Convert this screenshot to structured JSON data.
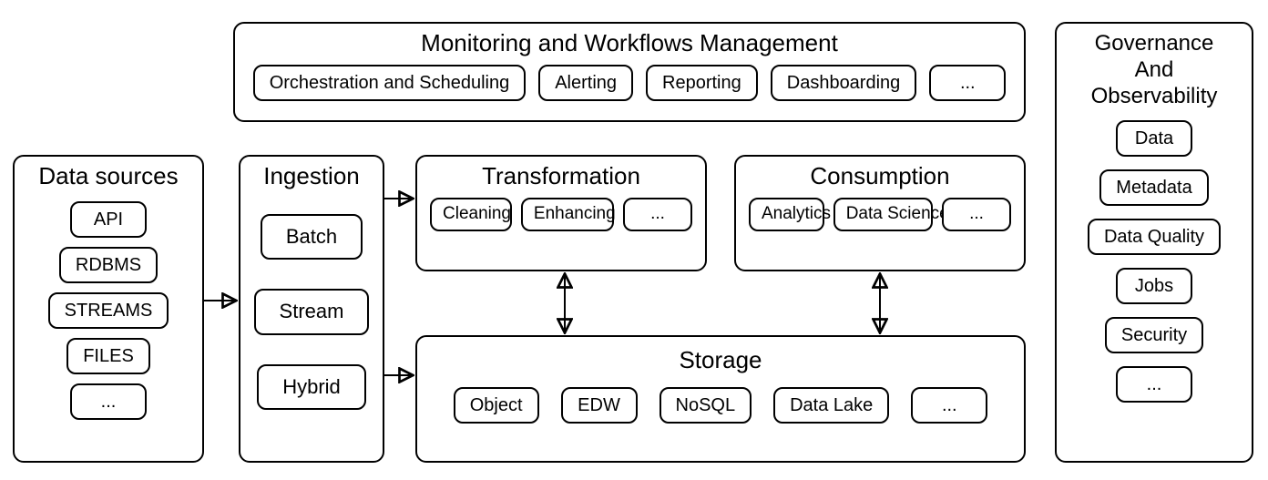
{
  "monitoring": {
    "title": "Monitoring and Workflows Management",
    "items": [
      "Orchestration and Scheduling",
      "Alerting",
      "Reporting",
      "Dashboarding",
      "..."
    ]
  },
  "data_sources": {
    "title": "Data sources",
    "items": [
      "API",
      "RDBMS",
      "STREAMS",
      "FILES",
      "..."
    ]
  },
  "ingestion": {
    "title": "Ingestion",
    "items": [
      "Batch",
      "Stream",
      "Hybrid"
    ]
  },
  "transformation": {
    "title": "Transformation",
    "items": [
      "Cleaning",
      "Enhancing",
      "..."
    ]
  },
  "consumption": {
    "title": "Consumption",
    "items": [
      "Analytics",
      "Data Science",
      "..."
    ]
  },
  "storage": {
    "title": "Storage",
    "items": [
      "Object",
      "EDW",
      "NoSQL",
      "Data Lake",
      "..."
    ]
  },
  "governance": {
    "title": "Governance\nAnd\nObservability",
    "items": [
      "Data",
      "Metadata",
      "Data Quality",
      "Jobs",
      "Security",
      "..."
    ]
  }
}
